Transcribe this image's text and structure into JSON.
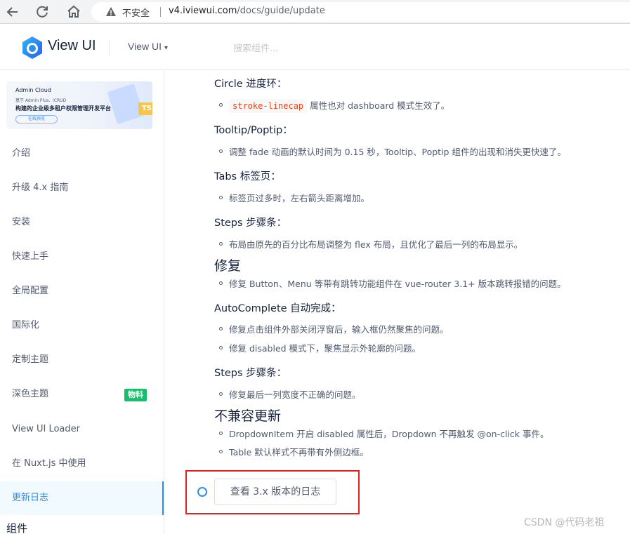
{
  "browser": {
    "back_icon": "arrow-left-icon",
    "reload_icon": "reload-icon",
    "home_icon": "home-icon",
    "warning_icon": "warning-triangle-icon",
    "not_secure": "不安全",
    "url_host": "v4.iviewui.com",
    "url_path": "/docs/guide/update"
  },
  "header": {
    "brand": "View UI",
    "version_dropdown": "View UI",
    "search_placeholder": "搜索组件..."
  },
  "sidebar": {
    "banner": {
      "title": "Admin Cloud",
      "line1": "基于 Admin Plus、iCRUD",
      "line2": "构建的企业级多租户权限管理开发平台",
      "cta": "在线预览",
      "badge": "TS"
    },
    "items": [
      {
        "label": "介绍"
      },
      {
        "label": "升级 4.x 指南"
      },
      {
        "label": "安装"
      },
      {
        "label": "快速上手"
      },
      {
        "label": "全局配置"
      },
      {
        "label": "国际化"
      },
      {
        "label": "定制主题"
      },
      {
        "label": "深色主题",
        "badge": "物料"
      },
      {
        "label": "View UI Loader"
      },
      {
        "label": "在 Nuxt.js 中使用"
      },
      {
        "label": "更新日志",
        "active": true
      }
    ],
    "group": "组件"
  },
  "content": {
    "circle": {
      "title": "Circle 进度环：",
      "code": "stroke-linecap",
      "text": "属性也对 dashboard 模式生效了。"
    },
    "tooltip": {
      "title": "Tooltip/Poptip：",
      "item": "调整 fade 动画的默认时间为 0.15 秒，Tooltip、Poptip 组件的出现和消失更快速了。"
    },
    "tabs": {
      "title": "Tabs 标签页：",
      "item": "标签页过多时，左右箭头距离增加。"
    },
    "steps1": {
      "title": "Steps 步骤条：",
      "item": "布局由原先的百分比布局调整为 flex 布局，且优化了最后一列的布局显示。"
    },
    "fix": {
      "title": "修复",
      "item": "修复 Button、Menu 等带有跳转功能组件在 vue-router 3.1+ 版本跳转报错的问题。"
    },
    "autocomplete": {
      "title": "AutoComplete 自动完成：",
      "item1": "修复点击组件外部关闭浮窗后，输入框仍然聚焦的问题。",
      "item2": "修复 disabled 模式下，聚焦显示外轮廓的问题。"
    },
    "steps2": {
      "title": "Steps 步骤条：",
      "item": "修复最后一列宽度不正确的问题。"
    },
    "breaking": {
      "title": "不兼容更新",
      "item1": "DropdownItem 开启 disabled 属性后，Dropdown 不再触发 @on-click 事件。",
      "item2": "Table 默认样式不再带有外侧边框。"
    },
    "log_button": "查看 3.x 版本的日志"
  },
  "watermark": "CSDN @代码老祖",
  "colors": {
    "primary": "#2d8cf0",
    "code_text": "#ed4014",
    "highlight_box": "#e61f1f",
    "badge_green": "#19be6b"
  }
}
